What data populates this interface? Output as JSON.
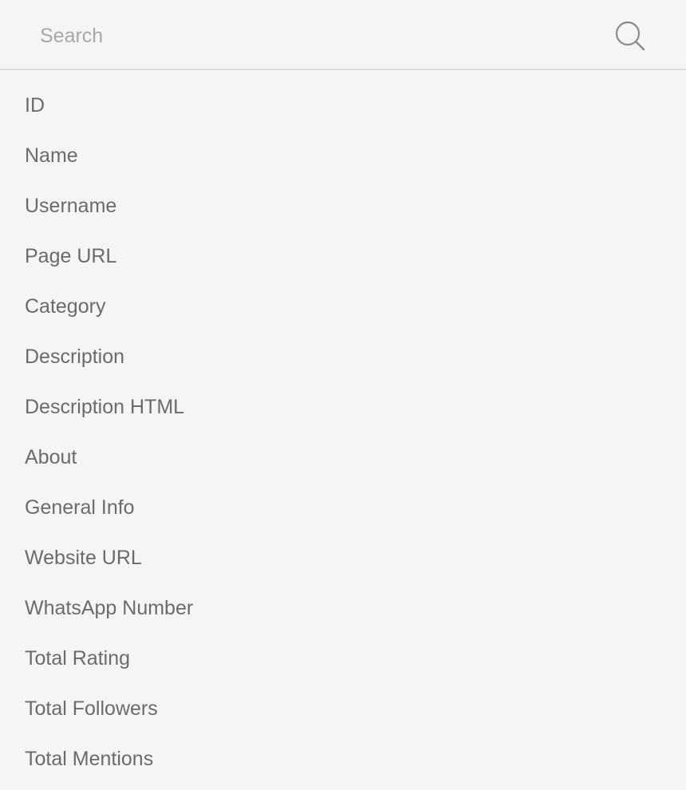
{
  "search": {
    "placeholder": "Search",
    "value": "",
    "icon": "search-icon"
  },
  "fields": [
    {
      "label": "ID"
    },
    {
      "label": "Name"
    },
    {
      "label": "Username"
    },
    {
      "label": "Page URL"
    },
    {
      "label": "Category"
    },
    {
      "label": "Description"
    },
    {
      "label": "Description HTML"
    },
    {
      "label": "About"
    },
    {
      "label": "General Info"
    },
    {
      "label": "Website URL"
    },
    {
      "label": "WhatsApp Number"
    },
    {
      "label": "Total Rating"
    },
    {
      "label": "Total Followers"
    },
    {
      "label": "Total Mentions"
    }
  ],
  "colors": {
    "background": "#f5f5f5",
    "text": "#6b6b6b",
    "placeholder": "#a8a8a8",
    "divider": "#dedede"
  }
}
